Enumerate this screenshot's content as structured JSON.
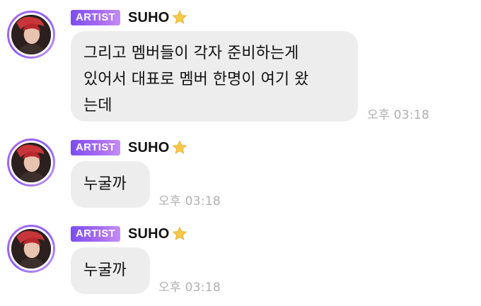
{
  "messages": [
    {
      "badge": "ARTIST",
      "sender": "SUHO",
      "text": "그리고 멤버들이 각자 준비하는게\n있어서 대표로 멤버 한명이 여기 왔\n는데",
      "time": "오후 03:18"
    },
    {
      "badge": "ARTIST",
      "sender": "SUHO",
      "text": "누굴까",
      "time": "오후 03:18"
    },
    {
      "badge": "ARTIST",
      "sender": "SUHO",
      "text": "누굴까",
      "time": "오후 03:18"
    }
  ],
  "icons": {
    "avatar": "profile-photo",
    "sender_badge_icon": "star-icon"
  },
  "colors": {
    "badge_gradient_start": "#7b4df0",
    "badge_gradient_end": "#c58df5",
    "avatar_ring": "#a86cf2",
    "bubble_background": "#ededed",
    "timestamp": "#b0b0b0",
    "star": "#f7c948"
  }
}
